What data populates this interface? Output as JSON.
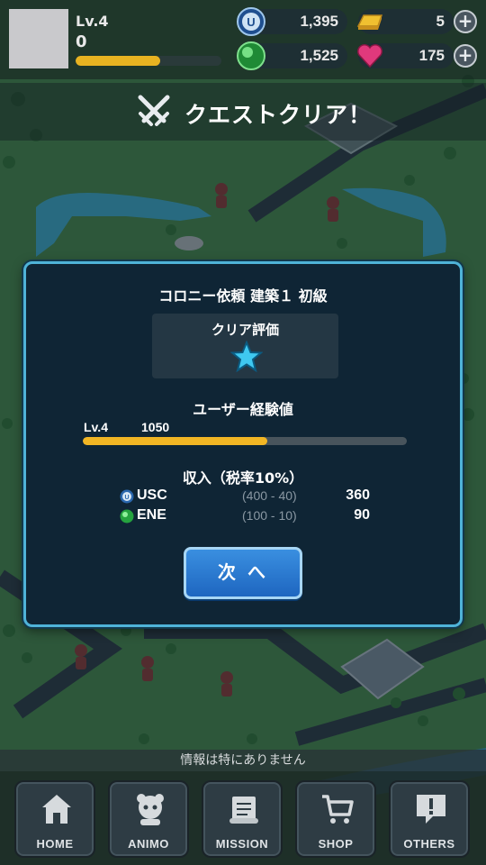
{
  "player": {
    "level": "Lv.4",
    "exp": "0",
    "exp_progress": 0.58
  },
  "resources": {
    "usc": "1,395",
    "gold": "5",
    "ene": "1,525",
    "heart": "175"
  },
  "banner": {
    "title": "クエストクリア！"
  },
  "dialog": {
    "title": "コロニー依頼 建築１ 初級",
    "eval_label": "クリア評価",
    "stars": 1,
    "exp_label": "ユーザー経験値",
    "exp_level": "Lv.4",
    "exp_value": "1050",
    "exp_progress": 0.57,
    "income_label": "収入（税率10%）",
    "income": [
      {
        "name": "USC",
        "calc": "(400 - 40)",
        "value": "360"
      },
      {
        "name": "ENE",
        "calc": "(100 - 10)",
        "value": "90"
      }
    ],
    "next_label": "次 へ"
  },
  "ticker": "情報は特にありません",
  "nav": [
    "HOME",
    "ANIMO",
    "MISSION",
    "SHOP",
    "OTHERS"
  ],
  "colors": {
    "accent": "#4fb3d8",
    "exp_bar": "#f2b624",
    "button": "#2a7bd4"
  }
}
